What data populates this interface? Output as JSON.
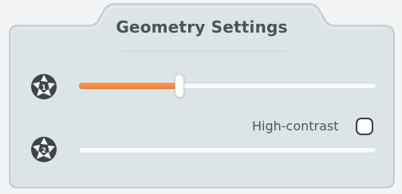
{
  "panel": {
    "title": "Geometry Settings",
    "background_color": "#dde4e7",
    "border_color": "#b9c3c7"
  },
  "slider_1": {
    "icon": "aperture-1-icon",
    "icon_label": "1",
    "value_fraction": 0.34,
    "fill_color": "#ee7d35"
  },
  "slider_2": {
    "icon": "aperture-2-icon",
    "icon_label": "2",
    "value_fraction": 0.0
  },
  "high_contrast": {
    "label": "High-contrast",
    "checked": false
  }
}
